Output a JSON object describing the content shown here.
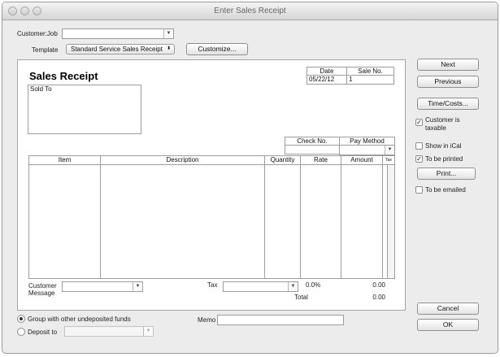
{
  "window": {
    "title": "Enter Sales Receipt"
  },
  "header": {
    "customer_job_label": "Customer:Job",
    "customer_job_value": "",
    "template_label": "Template",
    "template_value": "Standard Service Sales Receipt",
    "customize_label": "Customize..."
  },
  "form": {
    "title": "Sales Receipt",
    "date_label": "Date",
    "date_value": "05/22/12",
    "sale_no_label": "Sale No.",
    "sale_no_value": "1",
    "sold_to_label": "Sold To",
    "check_no_label": "Check No.",
    "check_no_value": "",
    "pay_method_label": "Pay Method",
    "pay_method_value": "",
    "columns": [
      "Item",
      "Description",
      "Quantity",
      "Rate",
      "Amount",
      "Tax"
    ],
    "customer_message_label": "Customer\nMessage",
    "customer_message_value": "",
    "tax_label": "Tax",
    "tax_value": "",
    "tax_rate": "0.0%",
    "tax_amount": "0.00",
    "total_label": "Total",
    "total_value": "0.00"
  },
  "side": {
    "next_label": "Next",
    "previous_label": "Previous",
    "time_costs_label": "Time/Costs...",
    "customer_taxable_label": "Customer is taxable",
    "customer_taxable_checked": true,
    "show_ical_label": "Show in iCal",
    "show_ical_checked": false,
    "to_be_printed_label": "To be printed",
    "to_be_printed_checked": true,
    "print_label": "Print...",
    "to_be_emailed_label": "To be emailed",
    "to_be_emailed_checked": false
  },
  "footer": {
    "group_label": "Group with other undeposited funds",
    "deposit_label": "Deposit to",
    "deposit_value": "",
    "memo_label": "Memo",
    "memo_value": "",
    "cancel_label": "Cancel",
    "ok_label": "OK"
  },
  "icons": {
    "dropdown": "chevron-down-icon",
    "updown": "updown-chevron-icon",
    "check": "checkmark-icon"
  }
}
